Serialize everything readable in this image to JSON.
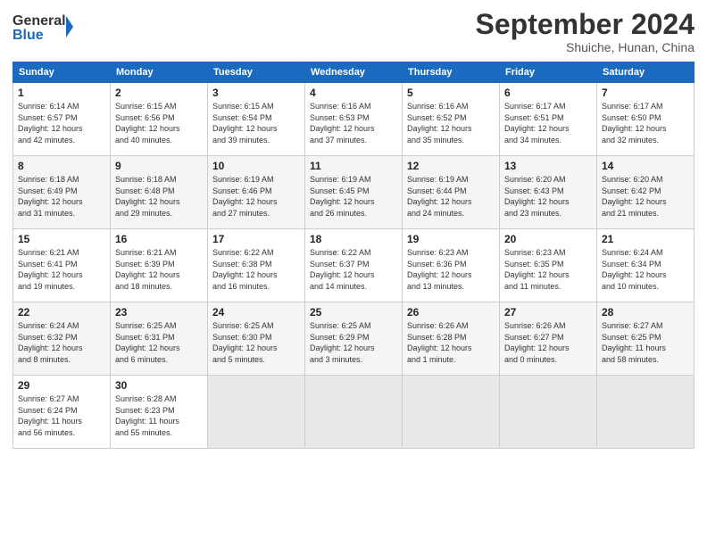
{
  "header": {
    "logo_line1": "General",
    "logo_line2": "Blue",
    "month": "September 2024",
    "location": "Shuiche, Hunan, China"
  },
  "weekdays": [
    "Sunday",
    "Monday",
    "Tuesday",
    "Wednesday",
    "Thursday",
    "Friday",
    "Saturday"
  ],
  "weeks": [
    [
      {
        "day": "1",
        "info": "Sunrise: 6:14 AM\nSunset: 6:57 PM\nDaylight: 12 hours\nand 42 minutes."
      },
      {
        "day": "2",
        "info": "Sunrise: 6:15 AM\nSunset: 6:56 PM\nDaylight: 12 hours\nand 40 minutes."
      },
      {
        "day": "3",
        "info": "Sunrise: 6:15 AM\nSunset: 6:54 PM\nDaylight: 12 hours\nand 39 minutes."
      },
      {
        "day": "4",
        "info": "Sunrise: 6:16 AM\nSunset: 6:53 PM\nDaylight: 12 hours\nand 37 minutes."
      },
      {
        "day": "5",
        "info": "Sunrise: 6:16 AM\nSunset: 6:52 PM\nDaylight: 12 hours\nand 35 minutes."
      },
      {
        "day": "6",
        "info": "Sunrise: 6:17 AM\nSunset: 6:51 PM\nDaylight: 12 hours\nand 34 minutes."
      },
      {
        "day": "7",
        "info": "Sunrise: 6:17 AM\nSunset: 6:50 PM\nDaylight: 12 hours\nand 32 minutes."
      }
    ],
    [
      {
        "day": "8",
        "info": "Sunrise: 6:18 AM\nSunset: 6:49 PM\nDaylight: 12 hours\nand 31 minutes."
      },
      {
        "day": "9",
        "info": "Sunrise: 6:18 AM\nSunset: 6:48 PM\nDaylight: 12 hours\nand 29 minutes."
      },
      {
        "day": "10",
        "info": "Sunrise: 6:19 AM\nSunset: 6:46 PM\nDaylight: 12 hours\nand 27 minutes."
      },
      {
        "day": "11",
        "info": "Sunrise: 6:19 AM\nSunset: 6:45 PM\nDaylight: 12 hours\nand 26 minutes."
      },
      {
        "day": "12",
        "info": "Sunrise: 6:19 AM\nSunset: 6:44 PM\nDaylight: 12 hours\nand 24 minutes."
      },
      {
        "day": "13",
        "info": "Sunrise: 6:20 AM\nSunset: 6:43 PM\nDaylight: 12 hours\nand 23 minutes."
      },
      {
        "day": "14",
        "info": "Sunrise: 6:20 AM\nSunset: 6:42 PM\nDaylight: 12 hours\nand 21 minutes."
      }
    ],
    [
      {
        "day": "15",
        "info": "Sunrise: 6:21 AM\nSunset: 6:41 PM\nDaylight: 12 hours\nand 19 minutes."
      },
      {
        "day": "16",
        "info": "Sunrise: 6:21 AM\nSunset: 6:39 PM\nDaylight: 12 hours\nand 18 minutes."
      },
      {
        "day": "17",
        "info": "Sunrise: 6:22 AM\nSunset: 6:38 PM\nDaylight: 12 hours\nand 16 minutes."
      },
      {
        "day": "18",
        "info": "Sunrise: 6:22 AM\nSunset: 6:37 PM\nDaylight: 12 hours\nand 14 minutes."
      },
      {
        "day": "19",
        "info": "Sunrise: 6:23 AM\nSunset: 6:36 PM\nDaylight: 12 hours\nand 13 minutes."
      },
      {
        "day": "20",
        "info": "Sunrise: 6:23 AM\nSunset: 6:35 PM\nDaylight: 12 hours\nand 11 minutes."
      },
      {
        "day": "21",
        "info": "Sunrise: 6:24 AM\nSunset: 6:34 PM\nDaylight: 12 hours\nand 10 minutes."
      }
    ],
    [
      {
        "day": "22",
        "info": "Sunrise: 6:24 AM\nSunset: 6:32 PM\nDaylight: 12 hours\nand 8 minutes."
      },
      {
        "day": "23",
        "info": "Sunrise: 6:25 AM\nSunset: 6:31 PM\nDaylight: 12 hours\nand 6 minutes."
      },
      {
        "day": "24",
        "info": "Sunrise: 6:25 AM\nSunset: 6:30 PM\nDaylight: 12 hours\nand 5 minutes."
      },
      {
        "day": "25",
        "info": "Sunrise: 6:25 AM\nSunset: 6:29 PM\nDaylight: 12 hours\nand 3 minutes."
      },
      {
        "day": "26",
        "info": "Sunrise: 6:26 AM\nSunset: 6:28 PM\nDaylight: 12 hours\nand 1 minute."
      },
      {
        "day": "27",
        "info": "Sunrise: 6:26 AM\nSunset: 6:27 PM\nDaylight: 12 hours\nand 0 minutes."
      },
      {
        "day": "28",
        "info": "Sunrise: 6:27 AM\nSunset: 6:25 PM\nDaylight: 11 hours\nand 58 minutes."
      }
    ],
    [
      {
        "day": "29",
        "info": "Sunrise: 6:27 AM\nSunset: 6:24 PM\nDaylight: 11 hours\nand 56 minutes."
      },
      {
        "day": "30",
        "info": "Sunrise: 6:28 AM\nSunset: 6:23 PM\nDaylight: 11 hours\nand 55 minutes."
      },
      {
        "day": "",
        "info": ""
      },
      {
        "day": "",
        "info": ""
      },
      {
        "day": "",
        "info": ""
      },
      {
        "day": "",
        "info": ""
      },
      {
        "day": "",
        "info": ""
      }
    ]
  ]
}
